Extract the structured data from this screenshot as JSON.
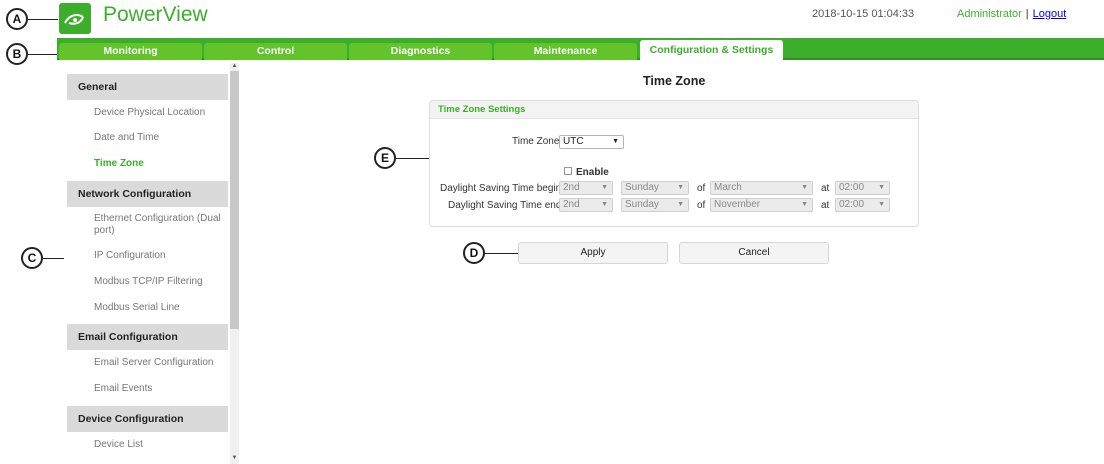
{
  "header": {
    "app_title": "PowerView",
    "datetime": "2018-10-15 01:04:33",
    "user": "Administrator",
    "separator": "|",
    "logout": "Logout"
  },
  "callouts": {
    "a": "A",
    "b": "B",
    "c": "C",
    "d": "D",
    "e": "E"
  },
  "nav": {
    "tabs": [
      {
        "label": "Monitoring",
        "active": false
      },
      {
        "label": "Control",
        "active": false
      },
      {
        "label": "Diagnostics",
        "active": false
      },
      {
        "label": "Maintenance",
        "active": false
      },
      {
        "label": "Configuration & Settings",
        "active": true
      }
    ]
  },
  "sidebar": {
    "sections": [
      {
        "title": "General",
        "items": [
          "Device Physical Location",
          "Date and Time",
          "Time Zone"
        ]
      },
      {
        "title": "Network Configuration",
        "items": [
          "Ethernet Configuration (Dual port)",
          "IP Configuration",
          "Modbus TCP/IP Filtering",
          "Modbus Serial Line"
        ]
      },
      {
        "title": "Email Configuration",
        "items": [
          "Email Server Configuration",
          "Email Events"
        ]
      },
      {
        "title": "Device Configuration",
        "items": [
          "Device List"
        ]
      }
    ],
    "active_item": "Time Zone"
  },
  "main": {
    "title": "Time Zone",
    "panel_title": "Time Zone Settings",
    "timezone_label": "Time Zone:",
    "timezone_value": "UTC",
    "enable_label": "Enable",
    "dst_begin_label": "Daylight Saving Time begins:",
    "dst_end_label": "Daylight Saving Time ends:",
    "of_label": "of",
    "at_label": "at",
    "dst_begin": {
      "week": "2nd",
      "day": "Sunday",
      "month": "March",
      "time": "02:00"
    },
    "dst_end": {
      "week": "2nd",
      "day": "Sunday",
      "month": "November",
      "time": "02:00"
    },
    "apply_label": "Apply",
    "cancel_label": "Cancel"
  },
  "colors": {
    "brand_green": "#3dae2b",
    "tab_green": "#63c32b"
  },
  "icons": {
    "logo": "plug-leaf-icon",
    "dropdown": "caret-down-icon",
    "scroll_up": "arrow-up-icon",
    "scroll_down": "arrow-down-icon"
  }
}
